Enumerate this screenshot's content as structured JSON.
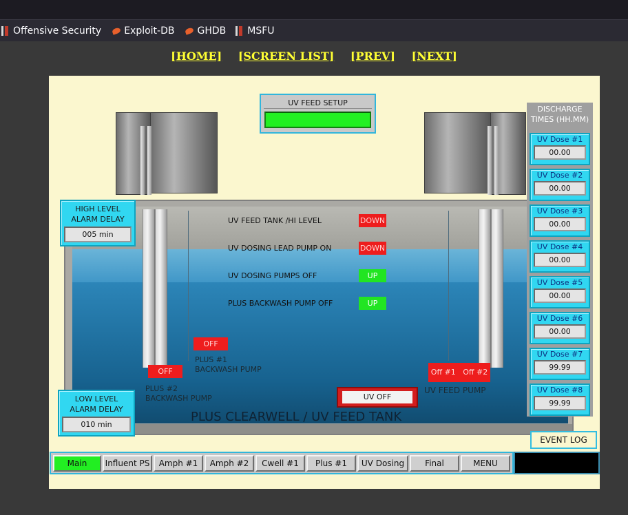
{
  "bookmarks": [
    {
      "label": "Offensive Security",
      "icon": "offsec-icon"
    },
    {
      "label": "Exploit-DB",
      "icon": "exploit-db-icon"
    },
    {
      "label": "GHDB",
      "icon": "ghdb-icon"
    },
    {
      "label": "MSFU",
      "icon": "msfu-icon"
    }
  ],
  "nav": {
    "home": "[HOME]",
    "screen_list": "[SCREEN LIST]",
    "prev": "[PREV]",
    "next": "[NEXT]"
  },
  "uv_feed_setup": {
    "label": "UV FEED SETUP",
    "status_color": "#22f022"
  },
  "high_alarm": {
    "label": "HIGH LEVEL\nALARM DELAY",
    "value": "005 min"
  },
  "low_alarm": {
    "label": "LOW LEVEL\nALARM DELAY",
    "value": "010 min"
  },
  "status": [
    {
      "label": "UV FEED TANK /HI LEVEL",
      "state": "DOWN",
      "color": "red"
    },
    {
      "label": "UV DOSING LEAD PUMP ON",
      "state": "DOWN",
      "color": "red"
    },
    {
      "label": "UV DOSING PUMPS OFF",
      "state": "UP",
      "color": "green"
    },
    {
      "label": "PLUS BACKWASH PUMP OFF",
      "state": "UP",
      "color": "green"
    }
  ],
  "pumps": {
    "plus1": {
      "state": "OFF",
      "label_1": "PLUS #1",
      "label_2": "BACKWASH PUMP"
    },
    "plus2": {
      "state": "OFF",
      "label_1": "PLUS #2",
      "label_2": "BACKWASH PUMP"
    },
    "uvfeed": {
      "state1": "Off #1",
      "state2": "Off #2",
      "label": "UV FEED PUMP"
    }
  },
  "uv_off": "UV OFF",
  "tank_title": "PLUS CLEARWELL / UV FEED TANK",
  "discharge": {
    "header_1": "DISCHARGE",
    "header_2": "TIMES (HH.MM)",
    "doses": [
      {
        "name": "UV Dose #1",
        "value": "00.00"
      },
      {
        "name": "UV Dose #2",
        "value": "00.00"
      },
      {
        "name": "UV Dose #3",
        "value": "00.00"
      },
      {
        "name": "UV Dose #4",
        "value": "00.00"
      },
      {
        "name": "UV Dose #5",
        "value": "00.00"
      },
      {
        "name": "UV Dose #6",
        "value": "00.00"
      },
      {
        "name": "UV Dose #7",
        "value": "99.99"
      },
      {
        "name": "UV Dose #8",
        "value": "99.99"
      }
    ]
  },
  "event_log": "EVENT LOG",
  "tabs": [
    {
      "label": "Main",
      "active": true
    },
    {
      "label": "Influent PS"
    },
    {
      "label": "Amph #1"
    },
    {
      "label": "Amph #2"
    },
    {
      "label": "Cwell #1"
    },
    {
      "label": "Plus #1"
    },
    {
      "label": "UV Dosing"
    },
    {
      "label": "Final"
    },
    {
      "label": "MENU"
    }
  ]
}
